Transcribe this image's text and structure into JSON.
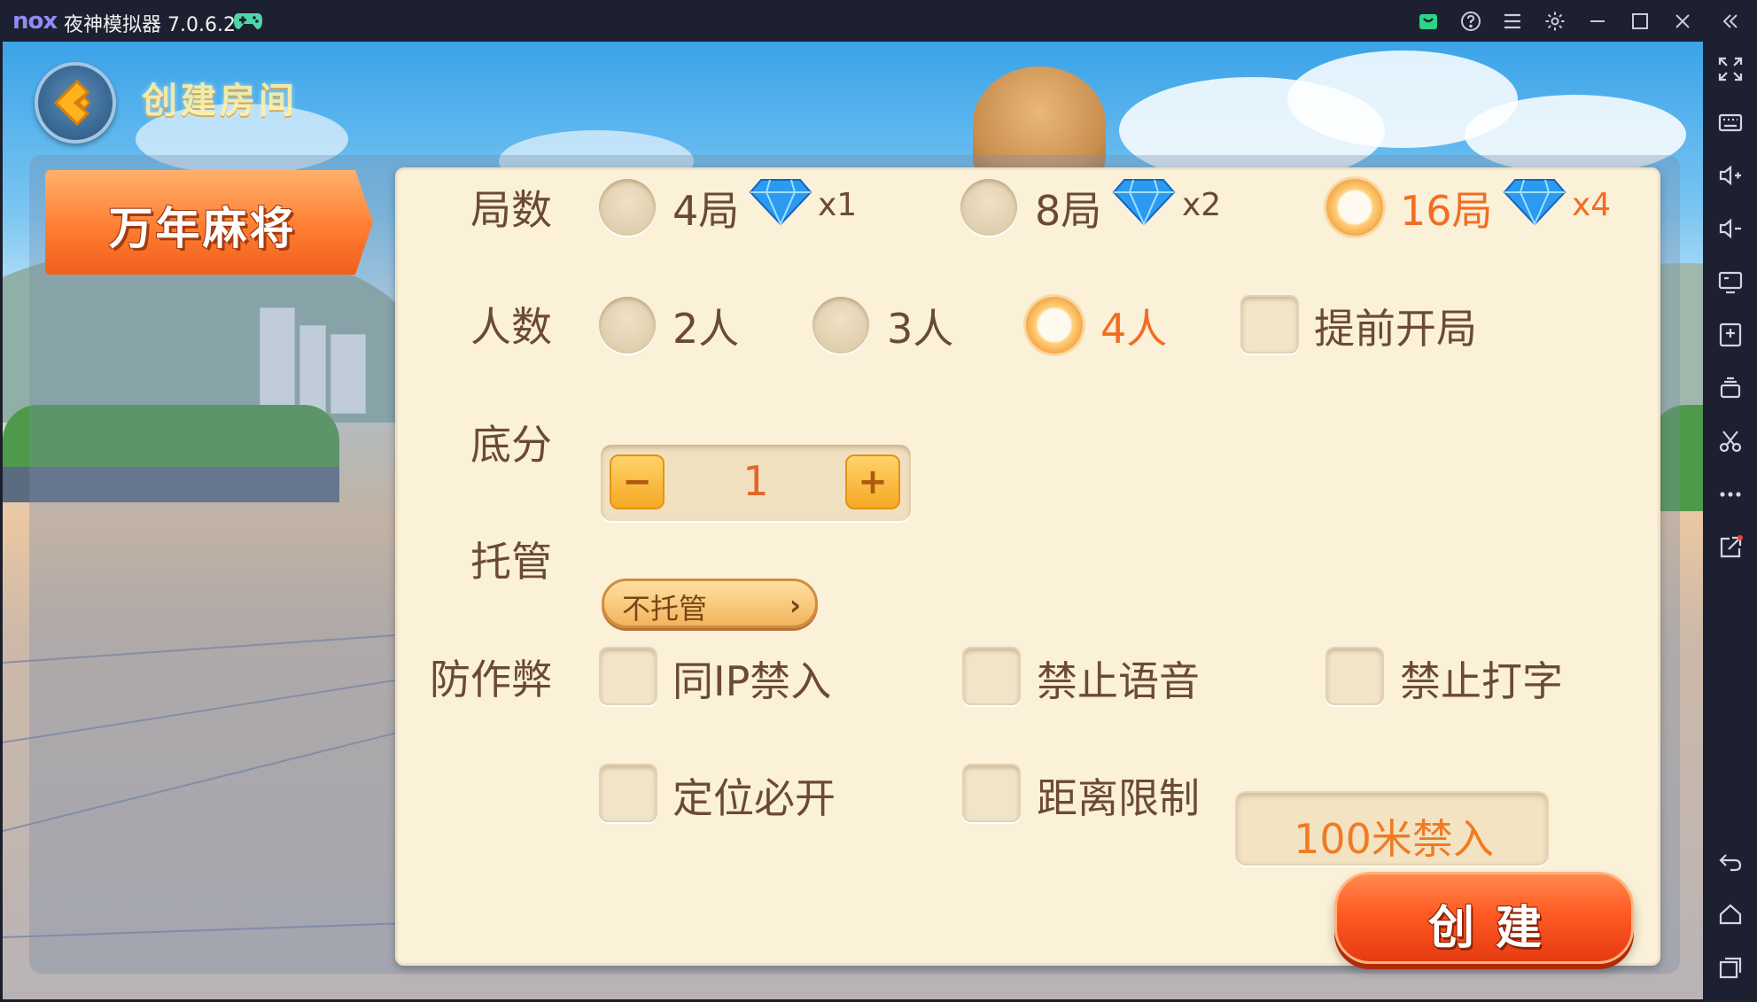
{
  "emulator": {
    "logo": "nox",
    "title": "夜神模拟器 7.0.6.2"
  },
  "game": {
    "page_title": "创建房间",
    "game_name": "万年麻将",
    "rows": {
      "rounds": {
        "label": "局数",
        "options": [
          {
            "text": "4局",
            "multiplier": "x1",
            "selected": false
          },
          {
            "text": "8局",
            "multiplier": "x2",
            "selected": false
          },
          {
            "text": "16局",
            "multiplier": "x4",
            "selected": true
          }
        ]
      },
      "players": {
        "label": "人数",
        "options": [
          {
            "text": "2人",
            "selected": false
          },
          {
            "text": "3人",
            "selected": false
          },
          {
            "text": "4人",
            "selected": true
          }
        ],
        "early_start": "提前开局"
      },
      "base_score": {
        "label": "底分",
        "value": "1",
        "minus": "−",
        "plus": "+"
      },
      "trustee": {
        "label": "托管",
        "value": "不托管",
        "arrow": "›"
      },
      "anti_cheat": {
        "label": "防作弊",
        "same_ip": "同IP禁入",
        "no_voice": "禁止语音",
        "no_typing": "禁止打字",
        "location": "定位必开",
        "distance": "距离限制",
        "distance_value": "100米禁入"
      }
    },
    "create_button": "创建"
  },
  "colors": {
    "panel": "#fbf0d8",
    "text": "#6b4a33",
    "accent": "#f26d22",
    "title_bar": "#1d2030"
  }
}
